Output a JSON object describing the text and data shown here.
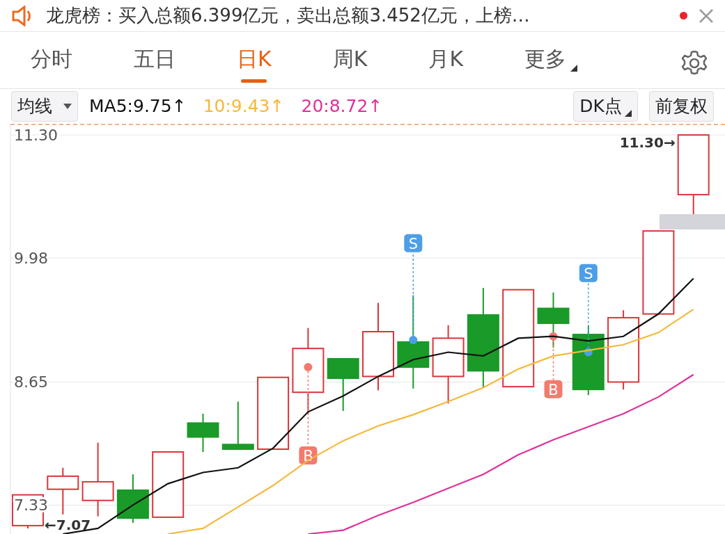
{
  "notice": {
    "text": "龙虎榜：买入总额6.399亿元，卖出总额3.452亿元，上榜…",
    "unread": true
  },
  "tabs": [
    {
      "label": "分时",
      "selected": false
    },
    {
      "label": "五日",
      "selected": false
    },
    {
      "label": "日K",
      "selected": true
    },
    {
      "label": "周K",
      "selected": false
    },
    {
      "label": "月K",
      "selected": false
    },
    {
      "label": "更多",
      "selected": false,
      "kind": "menu"
    }
  ],
  "toolbar": {
    "indicator": "均线",
    "ma": [
      {
        "text": "MA5:9.75↑",
        "color": "#111111"
      },
      {
        "text": "10:9.43↑",
        "color": "#f5b83d"
      },
      {
        "text": "20:8.72↑",
        "color": "#e0309a"
      }
    ],
    "buttons": [
      {
        "label": "DK点",
        "kind": "menu"
      },
      {
        "label": "前复权",
        "kind": "plain"
      }
    ]
  },
  "chart": {
    "chart_data": {
      "type": "line",
      "ylim": [
        7.02,
        11.42
      ],
      "grid": true,
      "yticks": [
        {
          "value": 11.3,
          "label": "11.30"
        },
        {
          "value": 9.98,
          "label": "9.98"
        },
        {
          "value": 8.65,
          "label": "8.65"
        },
        {
          "value": 7.33,
          "label": "7.33"
        }
      ],
      "series": [
        {
          "color": "#111111",
          "values": [
            null,
            7.02,
            7.08,
            7.33,
            7.56,
            7.68,
            7.73,
            7.94,
            8.33,
            8.5,
            8.71,
            8.89,
            8.97,
            8.93,
            9.12,
            9.14,
            9.09,
            9.14,
            9.38,
            9.76
          ]
        },
        {
          "color": "#f5b83d",
          "values": [
            null,
            null,
            null,
            null,
            7.02,
            7.08,
            7.31,
            7.54,
            7.81,
            8.02,
            8.18,
            8.3,
            8.44,
            8.59,
            8.79,
            8.93,
            8.99,
            9.05,
            9.18,
            9.43
          ]
        },
        {
          "color": "#e0309a",
          "values": [
            null,
            null,
            null,
            null,
            null,
            null,
            null,
            null,
            7.02,
            7.06,
            7.22,
            7.36,
            7.51,
            7.66,
            7.87,
            8.03,
            8.17,
            8.31,
            8.49,
            8.73
          ]
        }
      ]
    },
    "signals": [
      {
        "label": "B",
        "kind": "buy"
      },
      {
        "label": "S",
        "kind": "sell"
      },
      {
        "label": "B",
        "kind": "buy"
      },
      {
        "label": "S",
        "kind": "sell"
      }
    ],
    "price_marks": [
      {
        "text": "11.30→",
        "kind": "max"
      },
      {
        "text": "←7.07",
        "kind": "min"
      }
    ]
  }
}
